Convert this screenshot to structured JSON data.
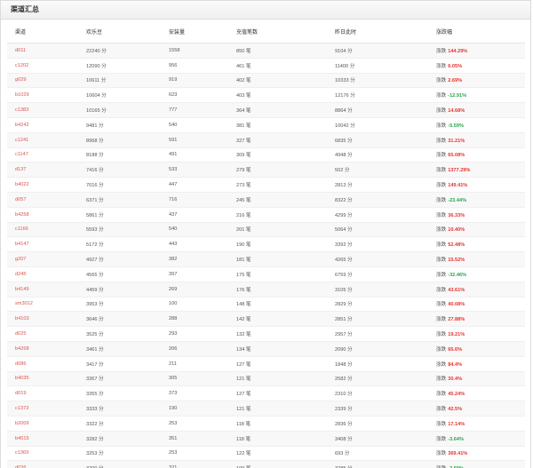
{
  "panel": {
    "title": "渠道汇总"
  },
  "table": {
    "headers": [
      "渠道",
      "欢乐豆",
      "安装量",
      "充值笔数",
      "昨日此时",
      "涨跌幅"
    ],
    "change_prefix": "涨跌",
    "rows": [
      {
        "channel": "d011",
        "beans": "22240 分",
        "installs": "1558",
        "recharges": "850 笔",
        "yesterday": "9104 分",
        "change": "144.29%",
        "dir": "up"
      },
      {
        "channel": "c1202",
        "beans": "12090 分",
        "installs": "956",
        "recharges": "461 笔",
        "yesterday": "11400 分",
        "change": "6.05%",
        "dir": "up"
      },
      {
        "channel": "g029",
        "beans": "10611 分",
        "installs": "919",
        "recharges": "402 笔",
        "yesterday": "10333 分",
        "change": "2.69%",
        "dir": "up"
      },
      {
        "channel": "b1029",
        "beans": "10604 分",
        "installs": "623",
        "recharges": "403 笔",
        "yesterday": "12176 分",
        "change": "-12.91%",
        "dir": "down"
      },
      {
        "channel": "c1383",
        "beans": "10165 分",
        "installs": "777",
        "recharges": "364 笔",
        "yesterday": "8864 分",
        "change": "14.68%",
        "dir": "up"
      },
      {
        "channel": "b4242",
        "beans": "9481 分",
        "installs": "540",
        "recharges": "381 笔",
        "yesterday": "10042 分",
        "change": "-5.59%",
        "dir": "down"
      },
      {
        "channel": "c1241",
        "beans": "8968 分",
        "installs": "591",
        "recharges": "327 笔",
        "yesterday": "6835 分",
        "change": "31.21%",
        "dir": "up"
      },
      {
        "channel": "c1147",
        "beans": "8188 分",
        "installs": "491",
        "recharges": "309 笔",
        "yesterday": "4948 分",
        "change": "65.08%",
        "dir": "up"
      },
      {
        "channel": "d137",
        "beans": "7416 分",
        "installs": "533",
        "recharges": "279 笔",
        "yesterday": "502 分",
        "change": "1377.29%",
        "dir": "up"
      },
      {
        "channel": "b4022",
        "beans": "7016 分",
        "installs": "447",
        "recharges": "273 笔",
        "yesterday": "2813 分",
        "change": "149.41%",
        "dir": "up"
      },
      {
        "channel": "d057",
        "beans": "6371 分",
        "installs": "716",
        "recharges": "245 笔",
        "yesterday": "8322 分",
        "change": "-23.44%",
        "dir": "down"
      },
      {
        "channel": "b4258",
        "beans": "5861 分",
        "installs": "437",
        "recharges": "216 笔",
        "yesterday": "4299 分",
        "change": "36.33%",
        "dir": "up"
      },
      {
        "channel": "c1166",
        "beans": "5593 分",
        "installs": "540",
        "recharges": "201 笔",
        "yesterday": "5064 分",
        "change": "10.40%",
        "dir": "up"
      },
      {
        "channel": "b4147",
        "beans": "5172 分",
        "installs": "443",
        "recharges": "190 笔",
        "yesterday": "3392 分",
        "change": "52.48%",
        "dir": "up"
      },
      {
        "channel": "g207",
        "beans": "4927 分",
        "installs": "382",
        "recharges": "181 笔",
        "yesterday": "4265 分",
        "change": "15.52%",
        "dir": "up"
      },
      {
        "channel": "d245",
        "beans": "4565 分",
        "installs": "397",
        "recharges": "175 笔",
        "yesterday": "6759 分",
        "change": "-32.46%",
        "dir": "down"
      },
      {
        "channel": "b4149",
        "beans": "4459 分",
        "installs": "269",
        "recharges": "176 笔",
        "yesterday": "3105 分",
        "change": "43.61%",
        "dir": "up"
      },
      {
        "channel": "sm3012",
        "beans": "3953 分",
        "installs": "100",
        "recharges": "148 笔",
        "yesterday": "2829 分",
        "change": "40.08%",
        "dir": "up"
      },
      {
        "channel": "b4103",
        "beans": "3646 分",
        "installs": "288",
        "recharges": "142 笔",
        "yesterday": "2851 分",
        "change": "27.88%",
        "dir": "up"
      },
      {
        "channel": "d025",
        "beans": "3525 分",
        "installs": "293",
        "recharges": "132 笔",
        "yesterday": "2957 分",
        "change": "19.21%",
        "dir": "up"
      },
      {
        "channel": "b4268",
        "beans": "3461 分",
        "installs": "206",
        "recharges": "134 笔",
        "yesterday": "2090 分",
        "change": "65.6%",
        "dir": "up"
      },
      {
        "channel": "d086",
        "beans": "3417 分",
        "installs": "211",
        "recharges": "127 笔",
        "yesterday": "1848 分",
        "change": "84.4%",
        "dir": "up"
      },
      {
        "channel": "b4035",
        "beans": "3367 分",
        "installs": "305",
        "recharges": "121 笔",
        "yesterday": "2582 分",
        "change": "30.4%",
        "dir": "up"
      },
      {
        "channel": "d019",
        "beans": "3355 分",
        "installs": "373",
        "recharges": "127 笔",
        "yesterday": "2310 分",
        "change": "45.24%",
        "dir": "up"
      },
      {
        "channel": "c1373",
        "beans": "3333 分",
        "installs": "190",
        "recharges": "121 笔",
        "yesterday": "2339 分",
        "change": "42.5%",
        "dir": "up"
      },
      {
        "channel": "b2009",
        "beans": "3322 分",
        "installs": "253",
        "recharges": "118 笔",
        "yesterday": "2836 分",
        "change": "17.14%",
        "dir": "up"
      },
      {
        "channel": "b4015",
        "beans": "3282 分",
        "installs": "351",
        "recharges": "118 笔",
        "yesterday": "3408 分",
        "change": "-3.64%",
        "dir": "down"
      },
      {
        "channel": "c1369",
        "beans": "3253 分",
        "installs": "253",
        "recharges": "122 笔",
        "yesterday": "693 分",
        "change": "369.41%",
        "dir": "up"
      },
      {
        "channel": "d026",
        "beans": "3200 分",
        "installs": "321",
        "recharges": "109 笔",
        "yesterday": "3285 分",
        "change": "-3.59%",
        "dir": "down"
      },
      {
        "channel": "b4150",
        "beans": "3184 分",
        "installs": "295",
        "recharges": "105 笔",
        "yesterday": "1111 分",
        "change": "186.59%",
        "dir": "up"
      }
    ]
  },
  "colors": {
    "up": "#e8322e",
    "down": "#2ea44f",
    "channel_link": "#d9534f"
  }
}
